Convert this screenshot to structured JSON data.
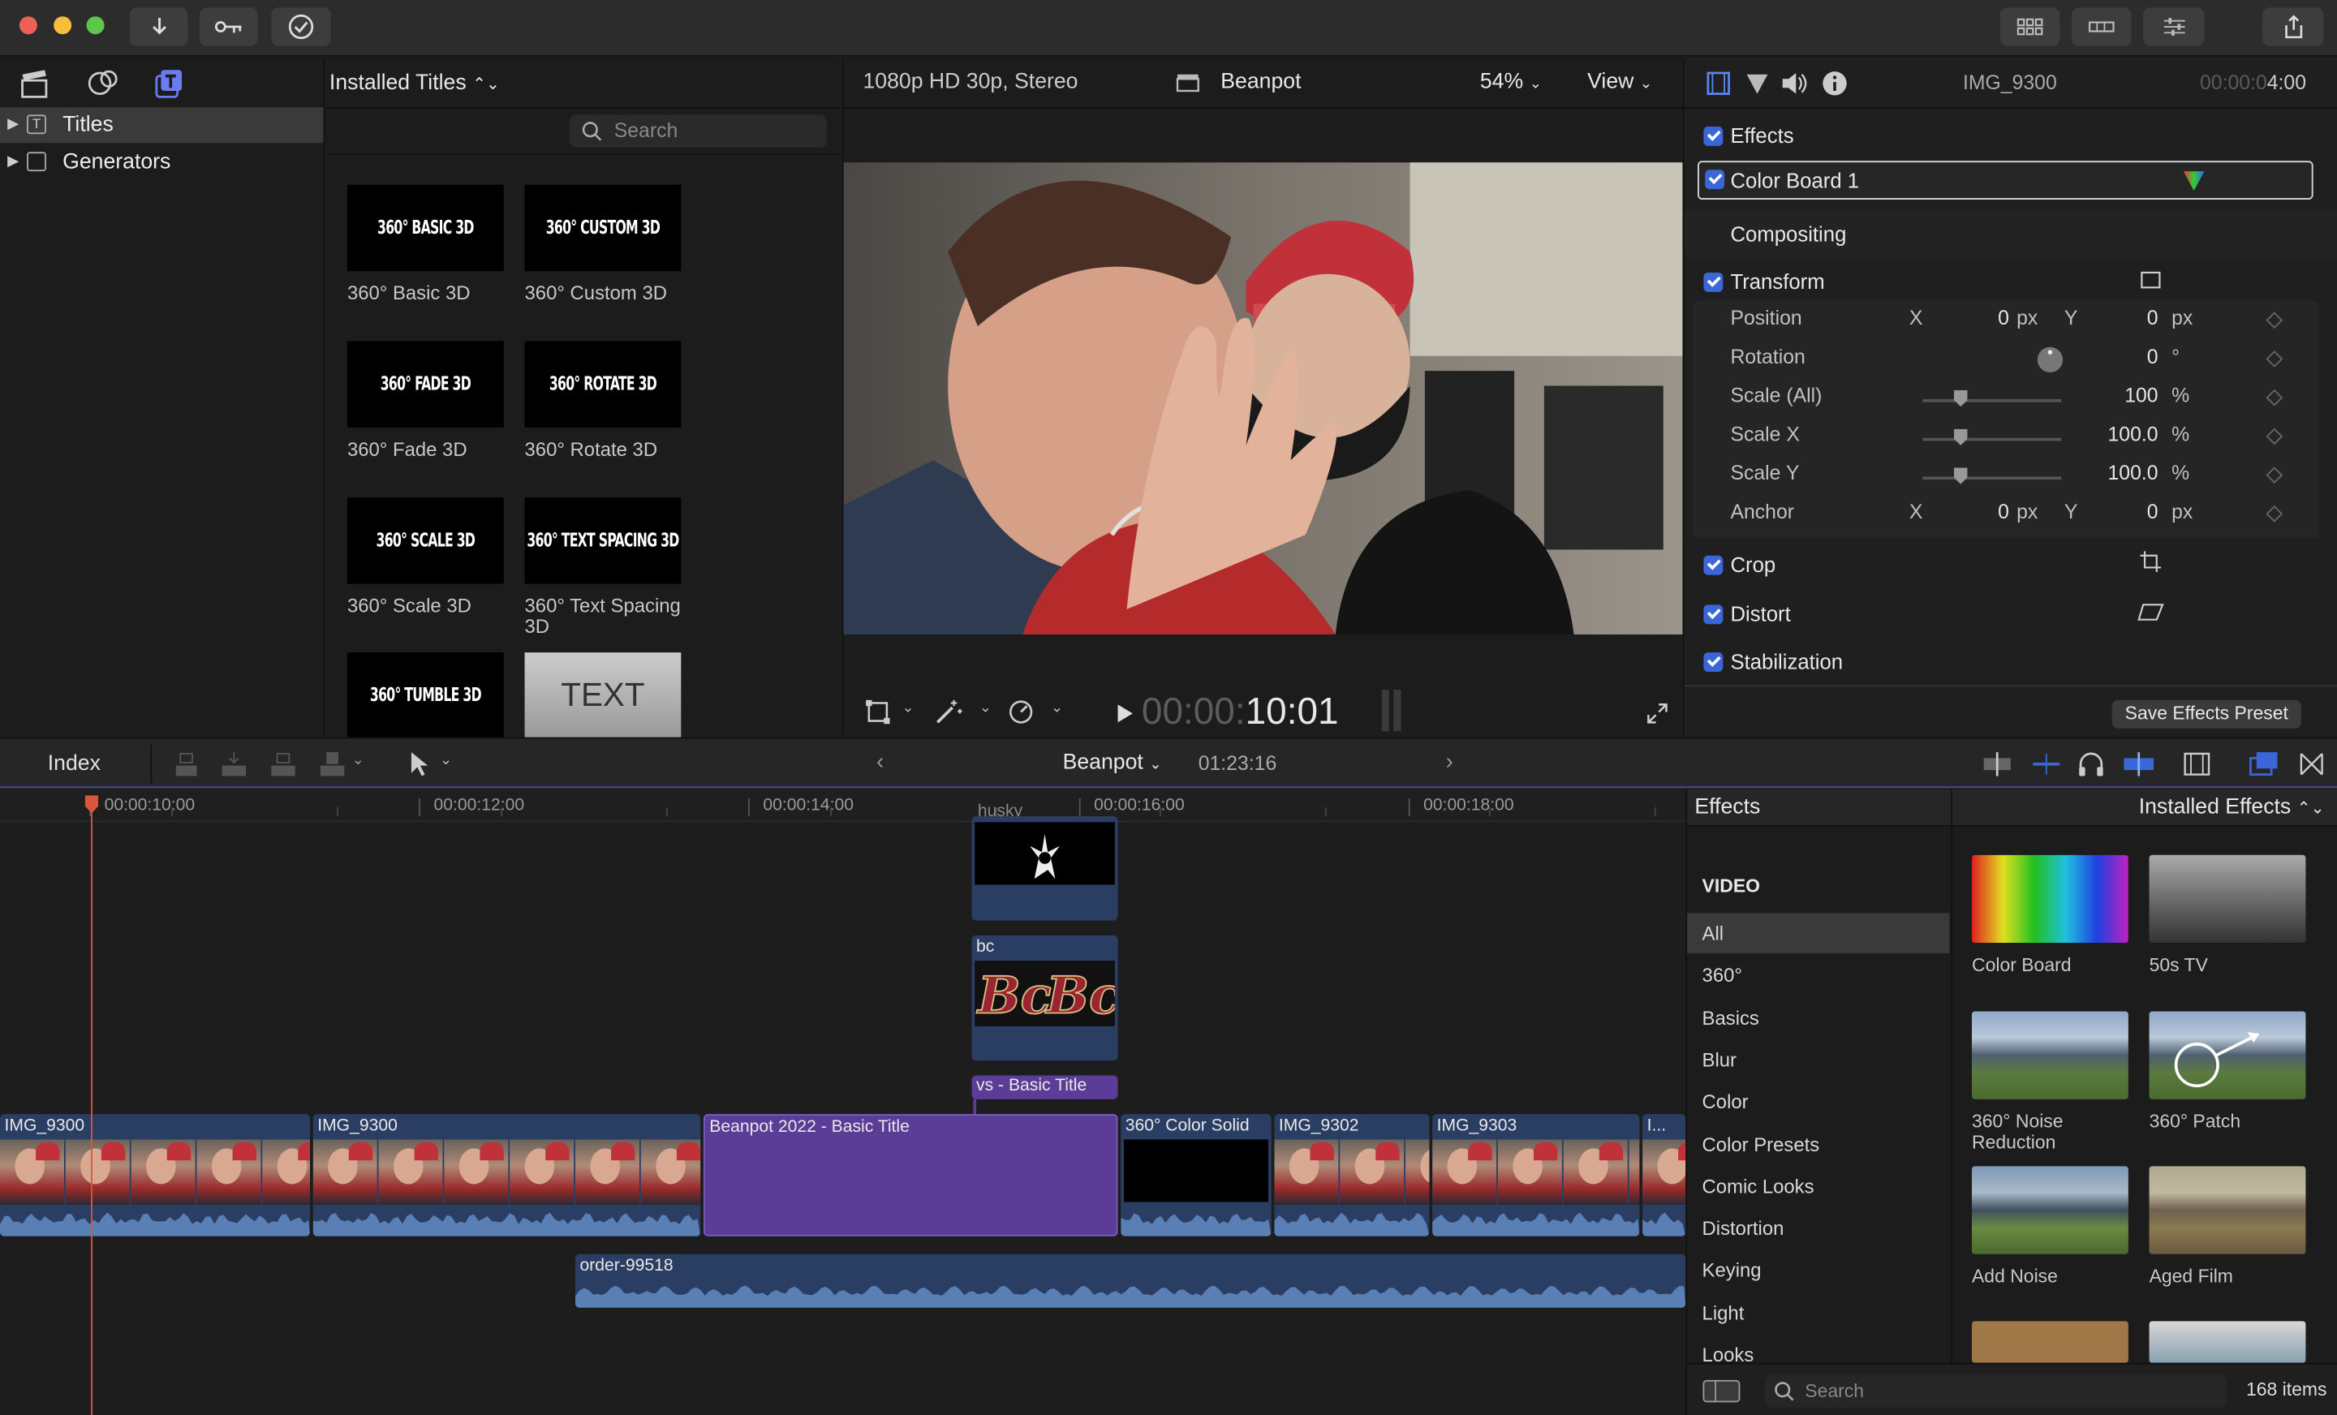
{
  "toolbar": {
    "buttons": [
      "import",
      "keywords",
      "background-tasks"
    ]
  },
  "browser": {
    "header": "Installed Titles",
    "search_placeholder": "Search",
    "sidebar": [
      {
        "label": "Titles"
      },
      {
        "label": "Generators"
      }
    ],
    "titles": [
      {
        "thumb": "360° BASIC 3D",
        "label": "360° Basic 3D"
      },
      {
        "thumb": "360° CUSTOM 3D",
        "label": "360° Custom 3D"
      },
      {
        "thumb": "360° FADE 3D",
        "label": "360° Fade 3D"
      },
      {
        "thumb": "360° ROTATE 3D",
        "label": "360° Rotate 3D"
      },
      {
        "thumb": "360° SCALE 3D",
        "label": "360° Scale 3D"
      },
      {
        "thumb": "360° TEXT SPACING 3D",
        "label": "360° Text Spacing 3D"
      },
      {
        "thumb": "360° TUMBLE 3D",
        "label": ""
      },
      {
        "thumb": "TEXT",
        "label": ""
      }
    ]
  },
  "viewer": {
    "format": "1080p HD 30p, Stereo",
    "project": "Beanpot",
    "zoom": "54%",
    "view": "View",
    "timecode_dim": "00:00:",
    "timecode": "10:01"
  },
  "inspector": {
    "clip": "IMG_9300",
    "tc_dim": "00:00:0",
    "tc": "4:00",
    "effects": "Effects",
    "color_board": "Color Board 1",
    "compositing": "Compositing",
    "transform": "Transform",
    "params": [
      {
        "name": "Position",
        "x": "0",
        "xu": "px",
        "y": "0",
        "yu": "px"
      },
      {
        "name": "Rotation",
        "v": "0",
        "u": "°"
      },
      {
        "name": "Scale (All)",
        "v": "100",
        "u": "%"
      },
      {
        "name": "Scale X",
        "v": "100.0",
        "u": "%"
      },
      {
        "name": "Scale Y",
        "v": "100.0",
        "u": "%"
      },
      {
        "name": "Anchor",
        "x": "0",
        "xu": "px",
        "y": "0",
        "yu": "px"
      }
    ],
    "x": "X",
    "y": "Y",
    "crop": "Crop",
    "distort": "Distort",
    "stabilization": "Stabilization",
    "save_preset": "Save Effects Preset"
  },
  "timeline": {
    "index": "Index",
    "project": "Beanpot",
    "duration": "01:23:16",
    "ruler": [
      "00:00:10:00",
      "00:00:12:00",
      "00:00:14:00",
      "00:00:16:00",
      "00:00:18:00"
    ],
    "clips": {
      "husky": "husky",
      "bc": "bc",
      "vs": "vs - Basic Title",
      "c1": "IMG_9300",
      "c2": "IMG_9300",
      "c3": "Beanpot 2022 - Basic Title",
      "c4": "360° Color Solid",
      "c5": "IMG_9302",
      "c6": "IMG_9303",
      "c7": "I...",
      "audio": "order-99518"
    }
  },
  "effects": {
    "title": "Effects",
    "dropdown": "Installed Effects",
    "section": "VIDEO",
    "categories": [
      "All",
      "360°",
      "Basics",
      "Blur",
      "Color",
      "Color Presets",
      "Comic Looks",
      "Distortion",
      "Keying",
      "Light",
      "Looks"
    ],
    "items": [
      "Color Board",
      "50s TV",
      "360° Noise Reduction",
      "360° Patch",
      "Add Noise",
      "Aged Film"
    ],
    "search_placeholder": "Search",
    "count": "168 items"
  },
  "colors": {
    "accent": "#3b66d8",
    "title_clip": "#5b3d98",
    "video_clip": "#2a4a7a",
    "playhead": "#e0553c"
  }
}
